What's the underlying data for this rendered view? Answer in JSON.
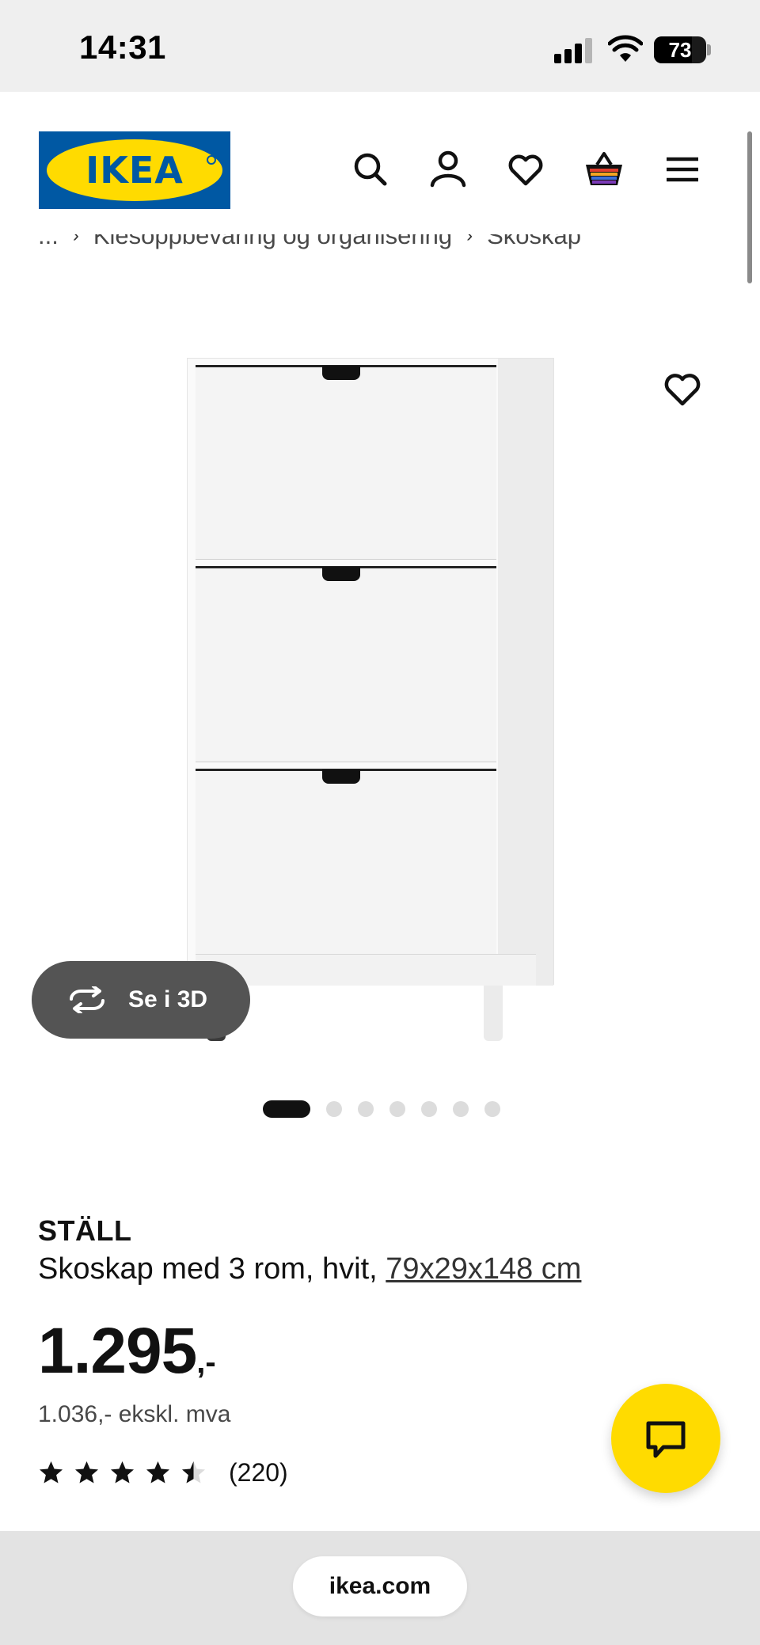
{
  "status_bar": {
    "time": "14:31",
    "battery_percent": "73"
  },
  "header": {
    "logo_text": "IKEA",
    "icons": [
      "search-icon",
      "account-icon",
      "favorites-icon",
      "cart-icon",
      "menu-icon"
    ]
  },
  "breadcrumb": {
    "items": [
      "...",
      "Klesoppbevaring og organisering",
      "Skoskap"
    ]
  },
  "gallery": {
    "view_3d_label": "Se i 3D",
    "image_count": 7,
    "active_index": 0
  },
  "product": {
    "name": "STÄLL",
    "description": "Skoskap med 3 rom, hvit, ",
    "size": "79x29x148 cm",
    "price_main": "1.295",
    "price_suffix": ",-",
    "price_ex_vat": "1.036,- ekskl. mva",
    "rating": 4.5,
    "rating_count": "(220)"
  },
  "browser": {
    "url": "ikea.com"
  },
  "colors": {
    "ikea_blue": "#0058a3",
    "ikea_yellow": "#ffdb00"
  }
}
